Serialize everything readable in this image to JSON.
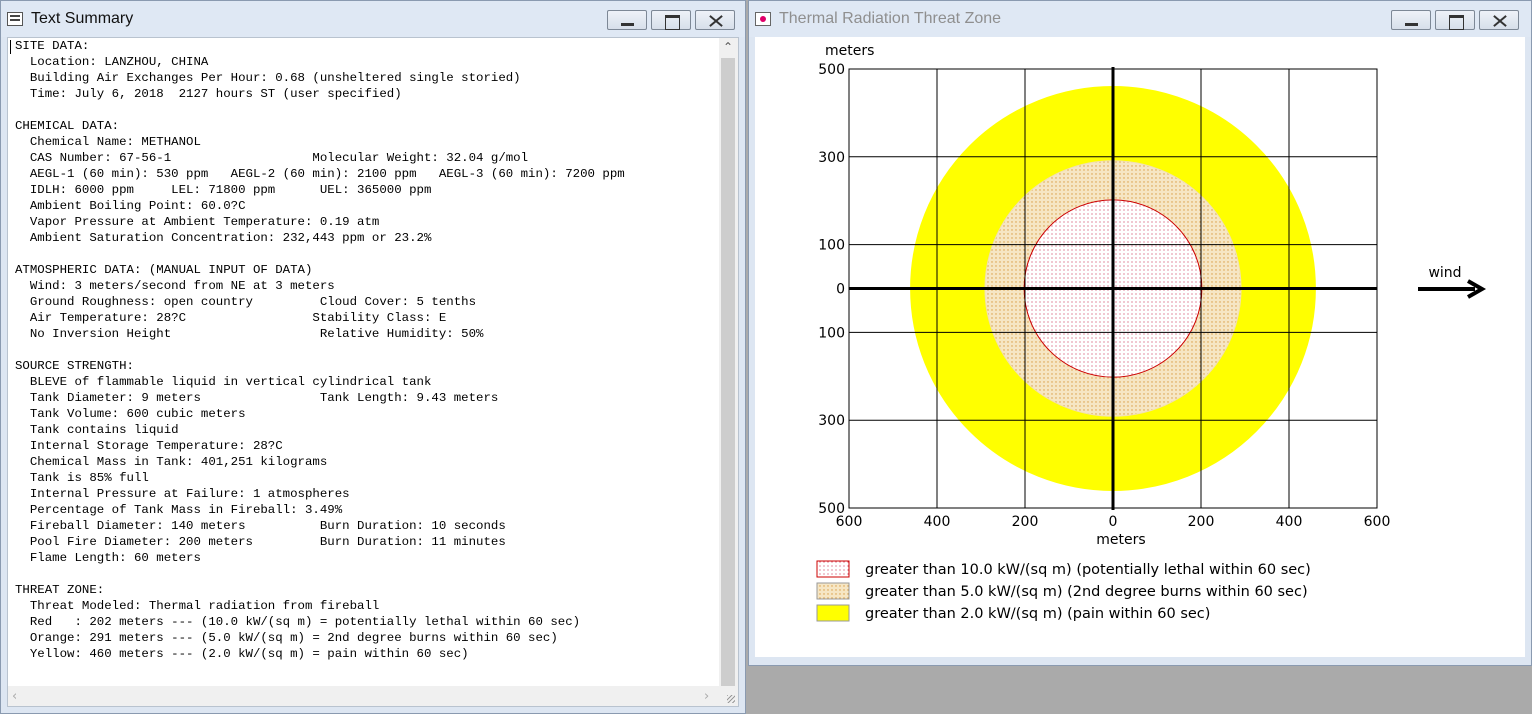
{
  "text_window": {
    "title": "Text Summary",
    "lines": [
      "SITE DATA:",
      "  Location: LANZHOU, CHINA",
      "  Building Air Exchanges Per Hour: 0.68 (unsheltered single storied)",
      "  Time: July 6, 2018  2127 hours ST (user specified)",
      "",
      "CHEMICAL DATA:",
      "  Chemical Name: METHANOL",
      "  CAS Number: 67-56-1                   Molecular Weight: 32.04 g/mol",
      "  AEGL-1 (60 min): 530 ppm   AEGL-2 (60 min): 2100 ppm   AEGL-3 (60 min): 7200 ppm",
      "  IDLH: 6000 ppm     LEL: 71800 ppm      UEL: 365000 ppm",
      "  Ambient Boiling Point: 60.0?C",
      "  Vapor Pressure at Ambient Temperature: 0.19 atm",
      "  Ambient Saturation Concentration: 232,443 ppm or 23.2%",
      "",
      "ATMOSPHERIC DATA: (MANUAL INPUT OF DATA)",
      "  Wind: 3 meters/second from NE at 3 meters",
      "  Ground Roughness: open country         Cloud Cover: 5 tenths",
      "  Air Temperature: 28?C                 Stability Class: E",
      "  No Inversion Height                    Relative Humidity: 50%",
      "",
      "SOURCE STRENGTH:",
      "  BLEVE of flammable liquid in vertical cylindrical tank",
      "  Tank Diameter: 9 meters                Tank Length: 9.43 meters",
      "  Tank Volume: 600 cubic meters",
      "  Tank contains liquid",
      "  Internal Storage Temperature: 28?C",
      "  Chemical Mass in Tank: 401,251 kilograms",
      "  Tank is 85% full",
      "  Internal Pressure at Failure: 1 atmospheres",
      "  Percentage of Tank Mass in Fireball: 3.49%",
      "  Fireball Diameter: 140 meters          Burn Duration: 10 seconds",
      "  Pool Fire Diameter: 200 meters         Burn Duration: 11 minutes",
      "  Flame Length: 60 meters",
      "",
      "THREAT ZONE:",
      "  Threat Modeled: Thermal radiation from fireball",
      "  Red   : 202 meters --- (10.0 kW/(sq m) = potentially lethal within 60 sec)",
      "  Orange: 291 meters --- (5.0 kW/(sq m) = 2nd degree burns within 60 sec)",
      "  Yellow: 460 meters --- (2.0 kW/(sq m) = pain within 60 sec)"
    ]
  },
  "threat_window": {
    "title": "Thermal Radiation Threat Zone",
    "wind_label": "wind"
  },
  "chart_data": {
    "type": "threat-zone",
    "ylabel": "meters",
    "xlabel": "meters",
    "xlim": [
      -600,
      600
    ],
    "ylim": [
      -500,
      500
    ],
    "x_ticks": [
      -600,
      -400,
      -200,
      0,
      200,
      400,
      600
    ],
    "x_tick_labels": [
      "600",
      "400",
      "200",
      "0",
      "200",
      "400",
      "600"
    ],
    "y_ticks": [
      500,
      300,
      100,
      0,
      -100,
      -300,
      -500
    ],
    "y_tick_labels": [
      "500",
      "300",
      "100",
      "0",
      "100",
      "300",
      "500"
    ],
    "grid": true,
    "zones": [
      {
        "name": "Yellow",
        "radius_m": 460,
        "fill": "#ffff00",
        "stroke": "#ffff00",
        "pattern": "solid"
      },
      {
        "name": "Orange",
        "radius_m": 291,
        "fill": "#f2e0b0",
        "stroke": "#f2e0b0",
        "pattern": "dots-orange"
      },
      {
        "name": "Red",
        "radius_m": 202,
        "fill": "#fbe4ec",
        "stroke": "#cc0000",
        "pattern": "dots-red"
      }
    ],
    "legend": [
      {
        "label": "greater than 10.0 kW/(sq m) (potentially lethal within 60 sec)",
        "pattern": "dots-red"
      },
      {
        "label": "greater than 5.0 kW/(sq m) (2nd degree burns within 60 sec)",
        "pattern": "dots-orange"
      },
      {
        "label": "greater than 2.0 kW/(sq m) (pain within 60 sec)",
        "pattern": "solid-yellow"
      }
    ]
  }
}
